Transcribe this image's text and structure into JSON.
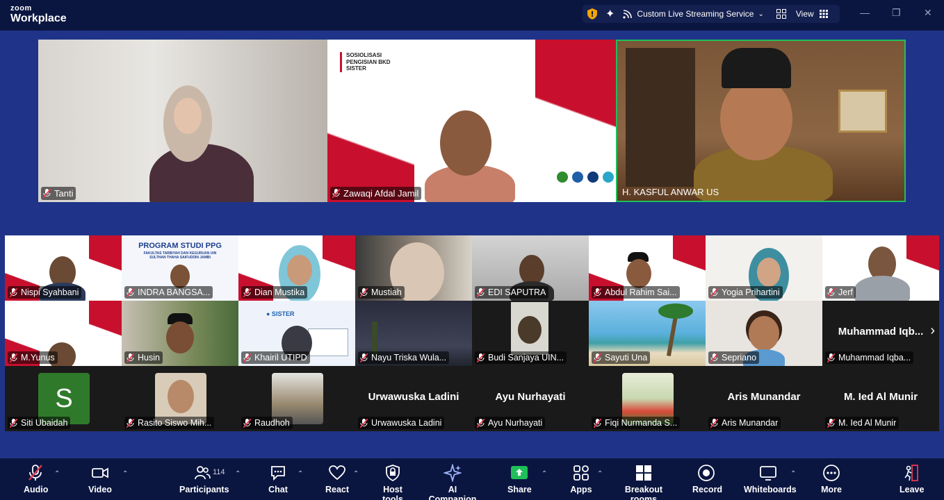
{
  "app": {
    "brand_top": "zoom",
    "brand_bottom": "Workplace"
  },
  "titlebar": {
    "stream_label": "Custom Live Streaming Service",
    "view_label": "View",
    "icons": [
      "shield-icon",
      "ai-sparkle-icon",
      "live-stream-icon",
      "gallery-grid-icon",
      "view-grid-icon",
      "minimize-icon",
      "maximize-icon",
      "close-icon"
    ]
  },
  "featured": [
    {
      "name": "Tanti"
    },
    {
      "name": "Zawaqi Afdal Jamil",
      "slide_title": "SOSIOLISASI\nPENGISIAN BKD\nSISTER"
    },
    {
      "name": "H. KASFUL ANWAR US",
      "active_speaker": true
    }
  ],
  "gallery_row1": [
    {
      "name": "Nispi Syahbani"
    },
    {
      "name": "INDRA BANGSA...",
      "banner_title": "PROGRAM STUDI PPG",
      "banner_sub": "FAKULTAS TARBIYAH DAN KEGURUAN UIN SULTHAN THAHA SAIFUDDIN JAMBI"
    },
    {
      "name": "Dian Mustika"
    },
    {
      "name": "Mustiah"
    },
    {
      "name": "EDI SAPUTRA"
    },
    {
      "name": "Abdul Rahim Sai..."
    },
    {
      "name": "Yogia Prihartini"
    },
    {
      "name": "Jerf"
    }
  ],
  "gallery_row2": [
    {
      "name": "M.Yunus"
    },
    {
      "name": "Husin"
    },
    {
      "name": "Khairil UTIPD"
    },
    {
      "name": "Nayu Triska Wula..."
    },
    {
      "name": "Budi Sanjaya UIN..."
    },
    {
      "name": "Sayuti Una"
    },
    {
      "name": "Sepriano"
    },
    {
      "name": "Muhammad Iqba...",
      "display": "Muhammad Iqb..."
    }
  ],
  "gallery_row3": [
    {
      "name": "Siti Ubaidah",
      "avatar_letter": "S"
    },
    {
      "name": "Rasito Siswo Mih..."
    },
    {
      "name": "Raudhoh"
    },
    {
      "name": "Urwawuska Ladini",
      "display": "Urwawuska Ladini"
    },
    {
      "name": "Ayu Nurhayati",
      "display": "Ayu Nurhayati"
    },
    {
      "name": "Fiqi Nurmanda S..."
    },
    {
      "name": "Aris Munandar",
      "display": "Aris Munandar"
    },
    {
      "name": "M. Ied Al Munir",
      "display": "M. Ied Al Munir"
    }
  ],
  "toolbar": {
    "audio": "Audio",
    "video": "Video",
    "participants": "Participants",
    "participants_count": "114",
    "chat": "Chat",
    "react": "React",
    "host_tools": "Host tools",
    "ai_companion": "AI Companion",
    "share": "Share",
    "apps": "Apps",
    "breakout": "Breakout rooms",
    "record": "Record",
    "whiteboards": "Whiteboards",
    "more": "More",
    "leave": "Leave"
  },
  "colors": {
    "accent_green": "#1fbf5a",
    "leave_red": "#e8374f",
    "stage_blue": "#1f3488"
  }
}
